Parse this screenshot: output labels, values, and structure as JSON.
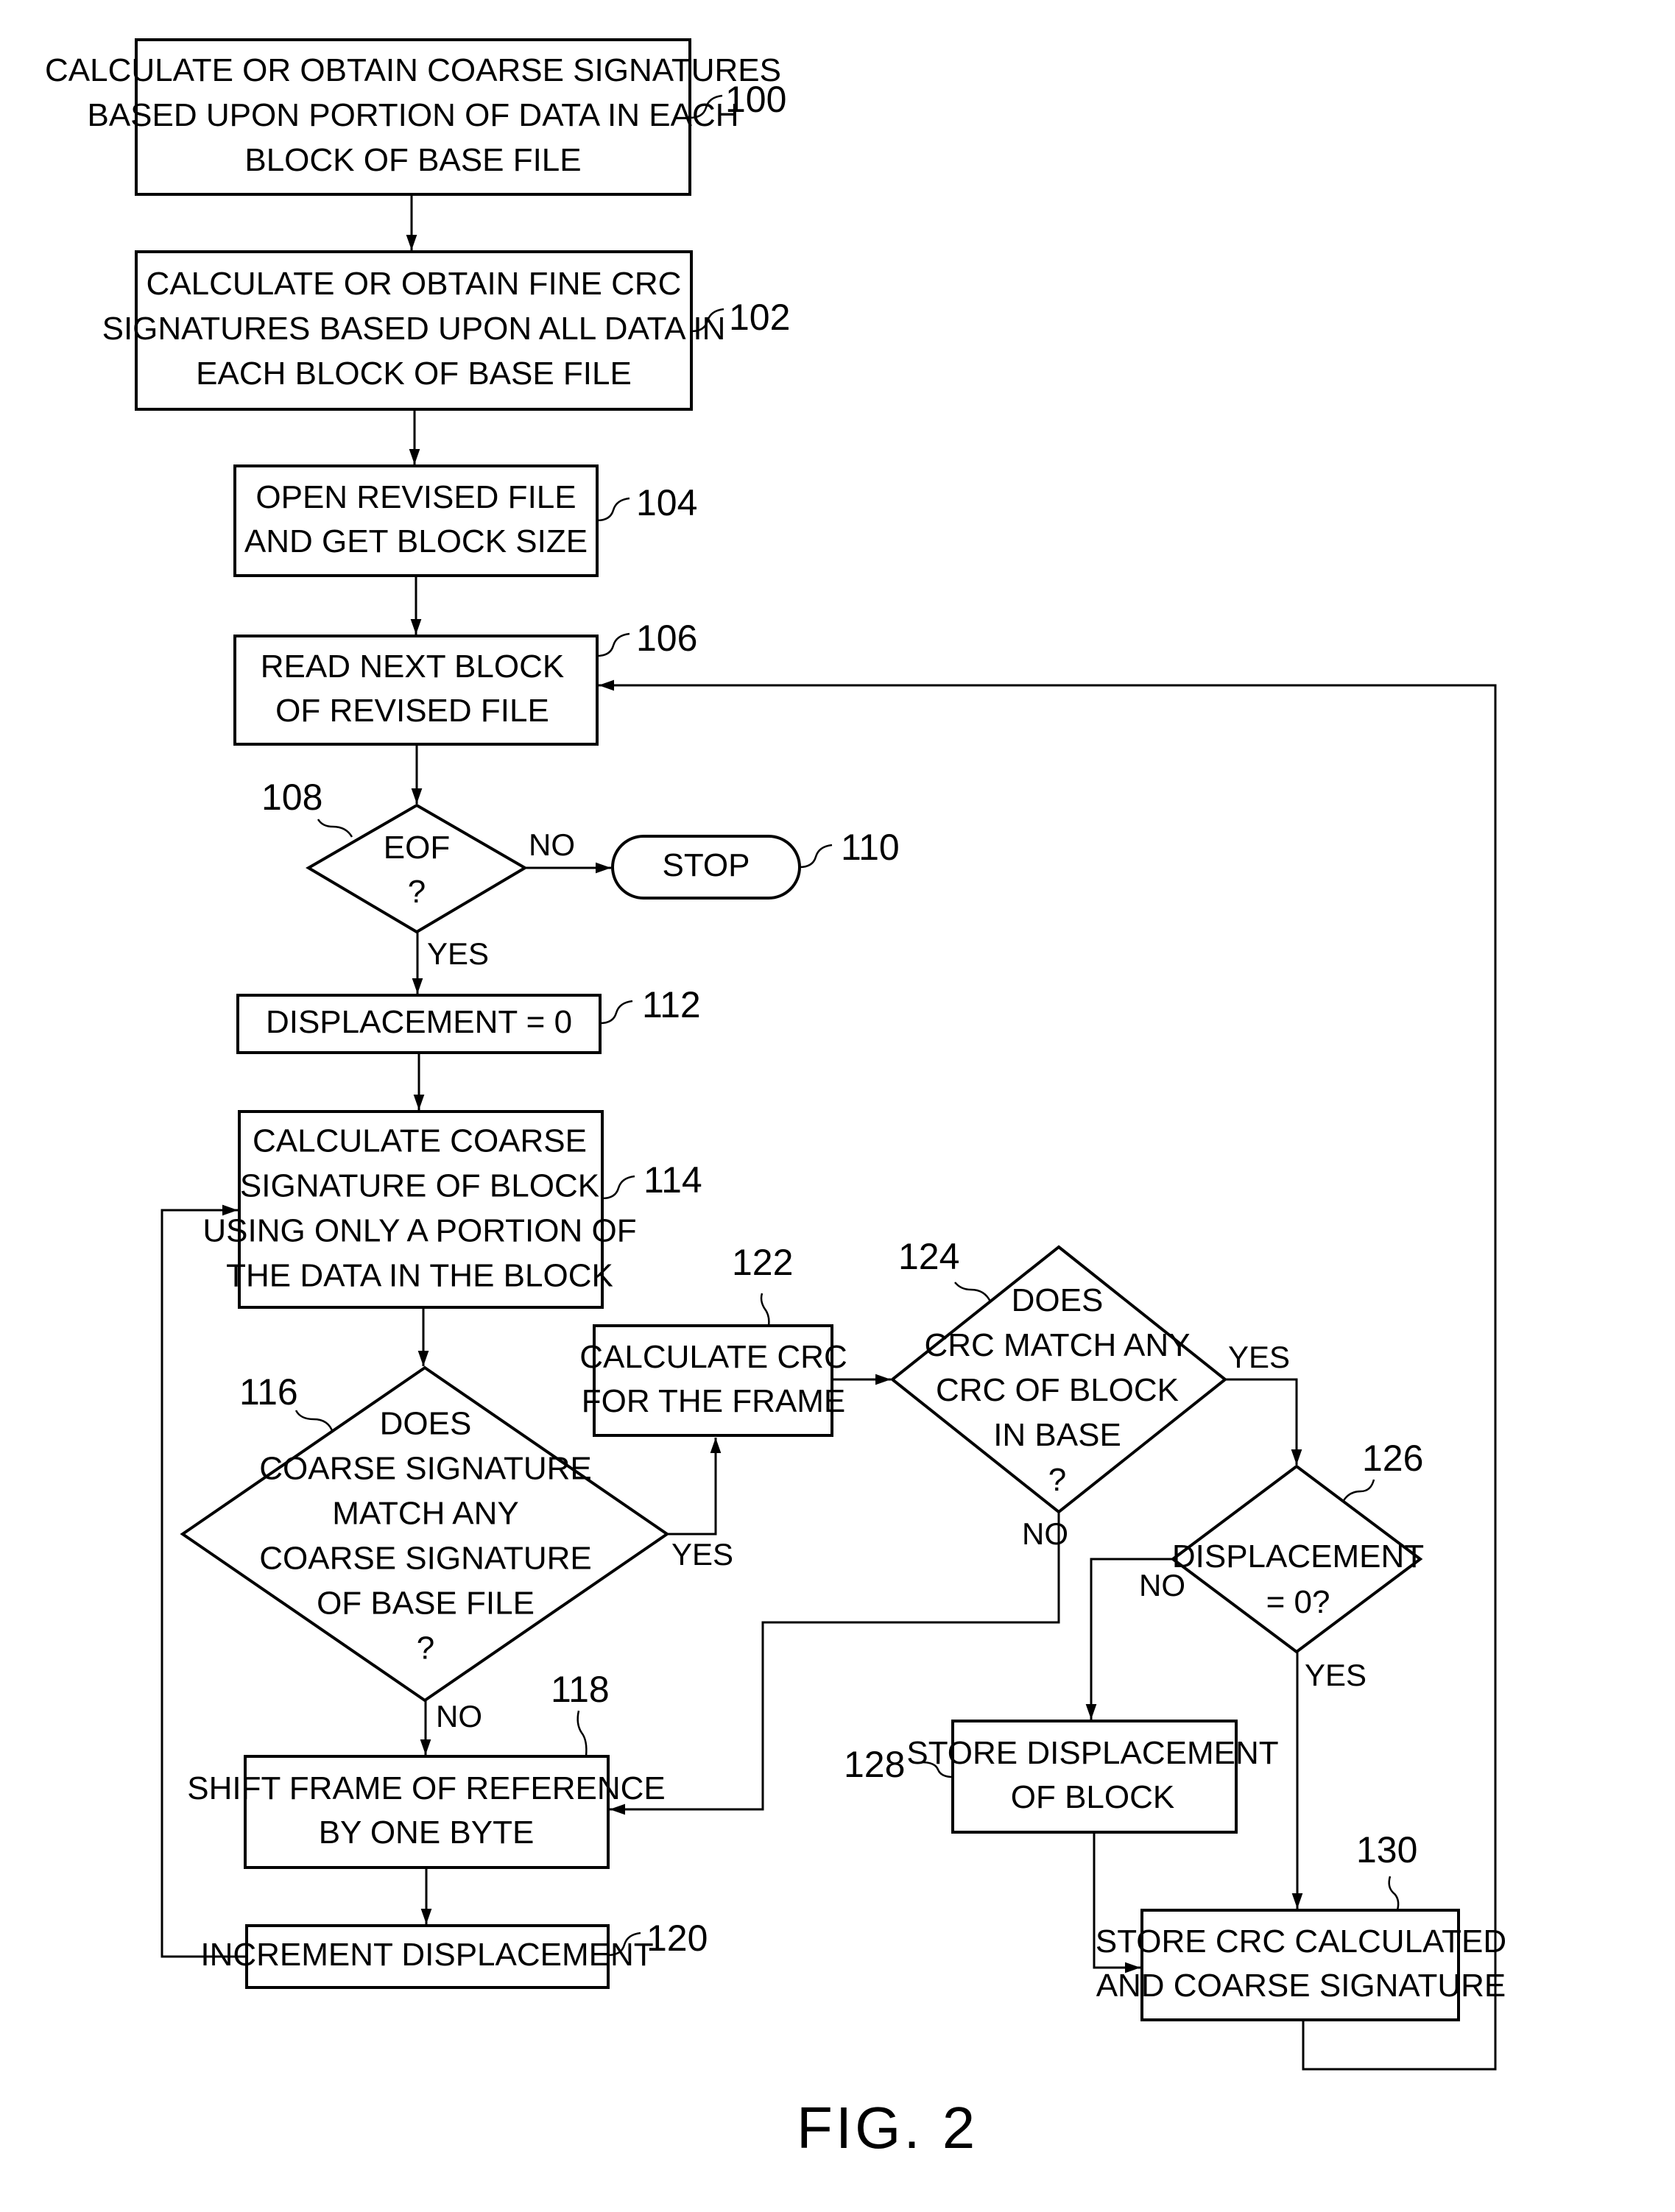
{
  "figure_label": "FIG. 2",
  "nodes": {
    "n100": {
      "ref": "100",
      "type": "process",
      "lines": [
        "CALCULATE OR OBTAIN COARSE SIGNATURES",
        "BASED UPON PORTION OF DATA IN EACH",
        "BLOCK OF BASE FILE"
      ]
    },
    "n102": {
      "ref": "102",
      "type": "process",
      "lines": [
        "CALCULATE OR OBTAIN FINE CRC",
        "SIGNATURES BASED UPON ALL DATA IN",
        "EACH BLOCK OF BASE FILE"
      ]
    },
    "n104": {
      "ref": "104",
      "type": "process",
      "lines": [
        "OPEN REVISED FILE",
        "AND GET BLOCK SIZE"
      ]
    },
    "n106": {
      "ref": "106",
      "type": "process",
      "lines": [
        "READ NEXT BLOCK",
        "OF REVISED FILE"
      ]
    },
    "n108": {
      "ref": "108",
      "type": "decision",
      "lines": [
        "EOF",
        "?"
      ]
    },
    "n110": {
      "ref": "110",
      "type": "terminal",
      "lines": [
        "STOP"
      ]
    },
    "n112": {
      "ref": "112",
      "type": "process",
      "lines": [
        "DISPLACEMENT = 0"
      ]
    },
    "n114": {
      "ref": "114",
      "type": "process",
      "lines": [
        "CALCULATE COARSE",
        "SIGNATURE OF BLOCK",
        "USING ONLY A PORTION OF",
        "THE DATA IN THE BLOCK"
      ]
    },
    "n116": {
      "ref": "116",
      "type": "decision",
      "lines": [
        "DOES",
        "COARSE SIGNATURE",
        "MATCH ANY",
        "COARSE SIGNATURE",
        "OF BASE FILE",
        "?"
      ]
    },
    "n118": {
      "ref": "118",
      "type": "process",
      "lines": [
        "SHIFT FRAME OF REFERENCE",
        "BY ONE BYTE"
      ]
    },
    "n120": {
      "ref": "120",
      "type": "process",
      "lines": [
        "INCREMENT DISPLACEMENT"
      ]
    },
    "n122": {
      "ref": "122",
      "type": "process",
      "lines": [
        "CALCULATE CRC",
        "FOR THE FRAME"
      ]
    },
    "n124": {
      "ref": "124",
      "type": "decision",
      "lines": [
        "DOES",
        "CRC MATCH ANY",
        "CRC OF BLOCK",
        "IN BASE",
        "?"
      ]
    },
    "n126": {
      "ref": "126",
      "type": "decision",
      "lines": [
        "DISPLACEMENT",
        "= 0?"
      ]
    },
    "n128": {
      "ref": "128",
      "type": "process",
      "lines": [
        "STORE DISPLACEMENT",
        "OF BLOCK"
      ]
    },
    "n130": {
      "ref": "130",
      "type": "process",
      "lines": [
        "STORE CRC CALCULATED",
        "AND COARSE SIGNATURE"
      ]
    }
  },
  "edges": [
    {
      "from": "100",
      "to": "102",
      "label": ""
    },
    {
      "from": "102",
      "to": "104",
      "label": ""
    },
    {
      "from": "104",
      "to": "106",
      "label": ""
    },
    {
      "from": "106",
      "to": "108",
      "label": ""
    },
    {
      "from": "108",
      "to": "110",
      "label": "NO"
    },
    {
      "from": "108",
      "to": "112",
      "label": "YES"
    },
    {
      "from": "112",
      "to": "114",
      "label": ""
    },
    {
      "from": "114",
      "to": "116",
      "label": ""
    },
    {
      "from": "116",
      "to": "122",
      "label": "YES"
    },
    {
      "from": "116",
      "to": "118",
      "label": "NO"
    },
    {
      "from": "118",
      "to": "120",
      "label": ""
    },
    {
      "from": "120",
      "to": "114",
      "label": ""
    },
    {
      "from": "122",
      "to": "124",
      "label": ""
    },
    {
      "from": "124",
      "to": "126",
      "label": "YES"
    },
    {
      "from": "124",
      "to": "118",
      "label": "NO"
    },
    {
      "from": "126",
      "to": "128",
      "label": "NO"
    },
    {
      "from": "126",
      "to": "130",
      "label": "YES"
    },
    {
      "from": "128",
      "to": "130",
      "label": ""
    },
    {
      "from": "130",
      "to": "106",
      "label": ""
    }
  ]
}
